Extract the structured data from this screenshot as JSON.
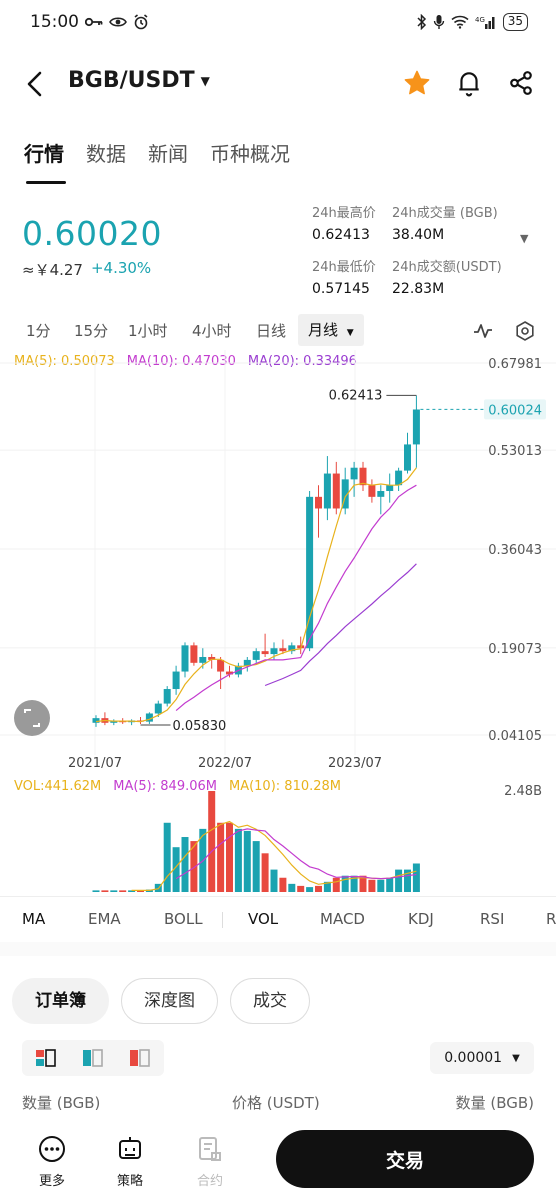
{
  "status_bar": {
    "time": "15:00",
    "battery": "35",
    "icons": [
      "key-icon",
      "eye-icon",
      "alarm-icon",
      "bluetooth-icon",
      "mic-icon",
      "wifi-icon",
      "signal-icon"
    ],
    "network": "4G"
  },
  "header": {
    "pair": "BGB/USDT",
    "favorited": true,
    "accent_color": "#f7931a"
  },
  "tabs": [
    {
      "label": "行情",
      "active": true
    },
    {
      "label": "数据",
      "active": false
    },
    {
      "label": "新闻",
      "active": false
    },
    {
      "label": "币种概况",
      "active": false
    }
  ],
  "ticker": {
    "price": "0.60020",
    "fiat": "≈￥4.27",
    "change": "+4.30%",
    "up_color": "#1ba3b0",
    "down_color": "#e8493f",
    "high_label": "24h最高价",
    "high_value": "0.62413",
    "low_label": "24h最低价",
    "low_value": "0.57145",
    "vol_label": "24h成交量 (BGB)",
    "vol_value": "38.40M",
    "amount_label": "24h成交额(USDT)",
    "amount_value": "22.83M"
  },
  "intervals": [
    {
      "label": "1分",
      "active": false
    },
    {
      "label": "15分",
      "active": false
    },
    {
      "label": "1小时",
      "active": false
    },
    {
      "label": "4小时",
      "active": false
    },
    {
      "label": "日线",
      "active": false
    },
    {
      "label": "月线",
      "active": true
    }
  ],
  "ma_legend": {
    "ma5": "MA(5): 0.50073",
    "ma10": "MA(10): 0.47030",
    "ma20": "MA(20): 0.33496"
  },
  "vol_legend": {
    "vol": "VOL:441.62M",
    "ma5": "MA(5): 849.06M",
    "ma10": "MA(10): 810.28M",
    "max": "2.48B"
  },
  "chart_data": {
    "type": "candlestick",
    "y_axis_labels": [
      "0.67981",
      "0.53013",
      "0.36043",
      "0.19073",
      "0.04105"
    ],
    "x_axis_labels": [
      "2021/07",
      "2022/07",
      "2023/07"
    ],
    "high_label": "0.62413",
    "low_label": "0.05830",
    "current_price_label": "0.60024",
    "ylim": [
      0.04105,
      0.67981
    ],
    "candles": [
      {
        "o": 0.062,
        "h": 0.075,
        "l": 0.055,
        "c": 0.07
      },
      {
        "o": 0.07,
        "h": 0.08,
        "l": 0.058,
        "c": 0.062
      },
      {
        "o": 0.062,
        "h": 0.068,
        "l": 0.058,
        "c": 0.065
      },
      {
        "o": 0.065,
        "h": 0.07,
        "l": 0.06,
        "c": 0.063
      },
      {
        "o": 0.063,
        "h": 0.068,
        "l": 0.058,
        "c": 0.066
      },
      {
        "o": 0.066,
        "h": 0.072,
        "l": 0.06,
        "c": 0.064
      },
      {
        "o": 0.064,
        "h": 0.08,
        "l": 0.06,
        "c": 0.078
      },
      {
        "o": 0.078,
        "h": 0.1,
        "l": 0.072,
        "c": 0.095
      },
      {
        "o": 0.095,
        "h": 0.125,
        "l": 0.09,
        "c": 0.12
      },
      {
        "o": 0.12,
        "h": 0.16,
        "l": 0.11,
        "c": 0.15
      },
      {
        "o": 0.15,
        "h": 0.2,
        "l": 0.14,
        "c": 0.195
      },
      {
        "o": 0.195,
        "h": 0.2,
        "l": 0.16,
        "c": 0.165
      },
      {
        "o": 0.165,
        "h": 0.19,
        "l": 0.155,
        "c": 0.175
      },
      {
        "o": 0.175,
        "h": 0.18,
        "l": 0.155,
        "c": 0.17
      },
      {
        "o": 0.17,
        "h": 0.175,
        "l": 0.12,
        "c": 0.15
      },
      {
        "o": 0.15,
        "h": 0.16,
        "l": 0.14,
        "c": 0.145
      },
      {
        "o": 0.145,
        "h": 0.165,
        "l": 0.14,
        "c": 0.16
      },
      {
        "o": 0.16,
        "h": 0.175,
        "l": 0.15,
        "c": 0.17
      },
      {
        "o": 0.17,
        "h": 0.19,
        "l": 0.165,
        "c": 0.185
      },
      {
        "o": 0.185,
        "h": 0.215,
        "l": 0.175,
        "c": 0.18
      },
      {
        "o": 0.18,
        "h": 0.2,
        "l": 0.17,
        "c": 0.19
      },
      {
        "o": 0.19,
        "h": 0.205,
        "l": 0.18,
        "c": 0.185
      },
      {
        "o": 0.185,
        "h": 0.2,
        "l": 0.18,
        "c": 0.195
      },
      {
        "o": 0.195,
        "h": 0.21,
        "l": 0.18,
        "c": 0.19
      },
      {
        "o": 0.19,
        "h": 0.46,
        "l": 0.185,
        "c": 0.45
      },
      {
        "o": 0.45,
        "h": 0.47,
        "l": 0.38,
        "c": 0.43
      },
      {
        "o": 0.43,
        "h": 0.52,
        "l": 0.41,
        "c": 0.49
      },
      {
        "o": 0.49,
        "h": 0.51,
        "l": 0.42,
        "c": 0.43
      },
      {
        "o": 0.43,
        "h": 0.5,
        "l": 0.42,
        "c": 0.48
      },
      {
        "o": 0.48,
        "h": 0.51,
        "l": 0.45,
        "c": 0.5
      },
      {
        "o": 0.5,
        "h": 0.51,
        "l": 0.46,
        "c": 0.47
      },
      {
        "o": 0.47,
        "h": 0.48,
        "l": 0.44,
        "c": 0.45
      },
      {
        "o": 0.45,
        "h": 0.47,
        "l": 0.42,
        "c": 0.46
      },
      {
        "o": 0.46,
        "h": 0.49,
        "l": 0.44,
        "c": 0.47
      },
      {
        "o": 0.47,
        "h": 0.5,
        "l": 0.46,
        "c": 0.495
      },
      {
        "o": 0.495,
        "h": 0.56,
        "l": 0.49,
        "c": 0.54
      },
      {
        "o": 0.54,
        "h": 0.624,
        "l": 0.5,
        "c": 0.6
      }
    ],
    "ma5": [
      0.064,
      0.066,
      0.065,
      0.065,
      0.065,
      0.064,
      0.068,
      0.075,
      0.084,
      0.102,
      0.128,
      0.146,
      0.161,
      0.171,
      0.171,
      0.163,
      0.158,
      0.16,
      0.162,
      0.168,
      0.176,
      0.182,
      0.187,
      0.189,
      0.243,
      0.29,
      0.347,
      0.4,
      0.45,
      0.47,
      0.473,
      0.47,
      0.472,
      0.47,
      0.47,
      0.48,
      0.5
    ],
    "ma10": [
      null,
      null,
      null,
      null,
      null,
      null,
      null,
      null,
      null,
      0.083,
      0.096,
      0.106,
      0.117,
      0.127,
      0.136,
      0.145,
      0.152,
      0.158,
      0.164,
      0.17,
      0.17,
      0.17,
      0.172,
      0.174,
      0.206,
      0.233,
      0.267,
      0.295,
      0.322,
      0.345,
      0.37,
      0.395,
      0.415,
      0.43,
      0.45,
      0.461,
      0.47
    ],
    "ma20": [
      null,
      null,
      null,
      null,
      null,
      null,
      null,
      null,
      null,
      null,
      null,
      null,
      null,
      null,
      null,
      null,
      null,
      null,
      null,
      0.126,
      0.132,
      0.138,
      0.145,
      0.152,
      0.168,
      0.182,
      0.198,
      0.212,
      0.227,
      0.24,
      0.253,
      0.266,
      0.28,
      0.293,
      0.307,
      0.32,
      0.335
    ],
    "volume": [
      0.04,
      0.04,
      0.04,
      0.04,
      0.04,
      0.04,
      0.06,
      0.2,
      1.7,
      1.1,
      1.35,
      1.25,
      1.55,
      2.48,
      1.7,
      1.7,
      1.55,
      1.5,
      1.25,
      0.95,
      0.55,
      0.35,
      0.2,
      0.15,
      0.12,
      0.15,
      0.25,
      0.35,
      0.4,
      0.4,
      0.4,
      0.3,
      0.3,
      0.35,
      0.55,
      0.55,
      0.7
    ],
    "vol_ma5": [
      null,
      null,
      null,
      null,
      0.04,
      0.04,
      0.04,
      0.08,
      0.38,
      0.62,
      0.88,
      1.12,
      1.39,
      1.53,
      1.66,
      1.73,
      1.59,
      1.64,
      1.54,
      1.39,
      1.16,
      0.92,
      0.66,
      0.44,
      0.27,
      0.19,
      0.22,
      0.25,
      0.31,
      0.34,
      0.35,
      0.34,
      0.33,
      0.34,
      0.4,
      0.46,
      0.51
    ],
    "vol_ma10": [
      null,
      null,
      null,
      null,
      null,
      null,
      null,
      null,
      null,
      0.33,
      0.46,
      0.6,
      0.76,
      1.0,
      1.18,
      1.35,
      1.5,
      1.55,
      1.52,
      1.5,
      1.29,
      1.13,
      0.95,
      0.77,
      0.62,
      0.56,
      0.44,
      0.36,
      0.37,
      0.38,
      0.37,
      0.34,
      0.33,
      0.34,
      0.37,
      0.4,
      0.43
    ],
    "vol_max": 2.48
  },
  "indicators": [
    {
      "label": "MA",
      "active": true
    },
    {
      "label": "EMA",
      "active": false
    },
    {
      "label": "BOLL",
      "active": false
    },
    {
      "label": "VOL",
      "active": true
    },
    {
      "label": "MACD",
      "active": false
    },
    {
      "label": "KDJ",
      "active": false
    },
    {
      "label": "RSI",
      "active": false
    },
    {
      "label": "R",
      "active": false
    }
  ],
  "orderbook": {
    "tabs": [
      {
        "label": "订单簿",
        "active": true
      },
      {
        "label": "深度图",
        "active": false
      },
      {
        "label": "成交",
        "active": false
      }
    ],
    "precision": "0.00001",
    "col_qty_bid": "数量 (BGB)",
    "col_price": "价格 (USDT)",
    "col_qty_ask": "数量 (BGB)"
  },
  "bottom_nav": {
    "more": "更多",
    "strategy": "策略",
    "contract": "合约",
    "trade": "交易"
  }
}
